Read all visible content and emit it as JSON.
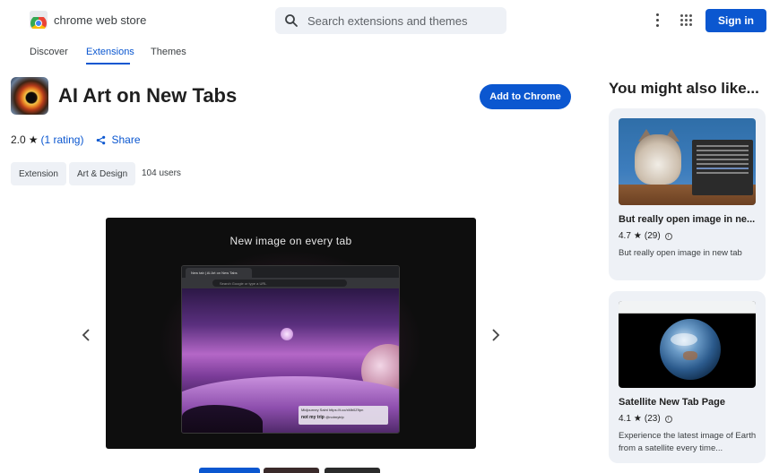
{
  "header": {
    "brand": "chrome web store",
    "search_placeholder": "Search extensions and themes",
    "sign_in": "Sign in"
  },
  "nav": {
    "tabs": [
      {
        "label": "Discover",
        "active": false
      },
      {
        "label": "Extensions",
        "active": true
      },
      {
        "label": "Themes",
        "active": false
      }
    ]
  },
  "item": {
    "title": "AI Art on New Tabs",
    "add_button": "Add to Chrome",
    "rating": "2.0",
    "rating_count": "(1 rating)",
    "share": "Share",
    "chips": [
      "Extension",
      "Art & Design"
    ],
    "users": "104 users"
  },
  "carousel": {
    "caption": "New image on every tab",
    "browser_tab": "New tab | AI Art on New Tabs",
    "address_placeholder": "Search Google or type a URL",
    "popup_link": "Midjourney Saint https://t.co/xMb0Z9pn",
    "popup_title": "not my trip",
    "popup_user": "@notmytrip"
  },
  "sidebar": {
    "title": "You might also like...",
    "cards": [
      {
        "name": "But really open image in ne...",
        "rating": "4.7",
        "count": "(29)",
        "description": "But really open image in new tab"
      },
      {
        "name": "Satellite New Tab Page",
        "rating": "4.1",
        "count": "(23)",
        "description": "Experience the latest image of Earth from a satellite every time..."
      }
    ]
  },
  "colors": {
    "accent": "#0b57d0",
    "chip_bg": "#eef1f6"
  }
}
